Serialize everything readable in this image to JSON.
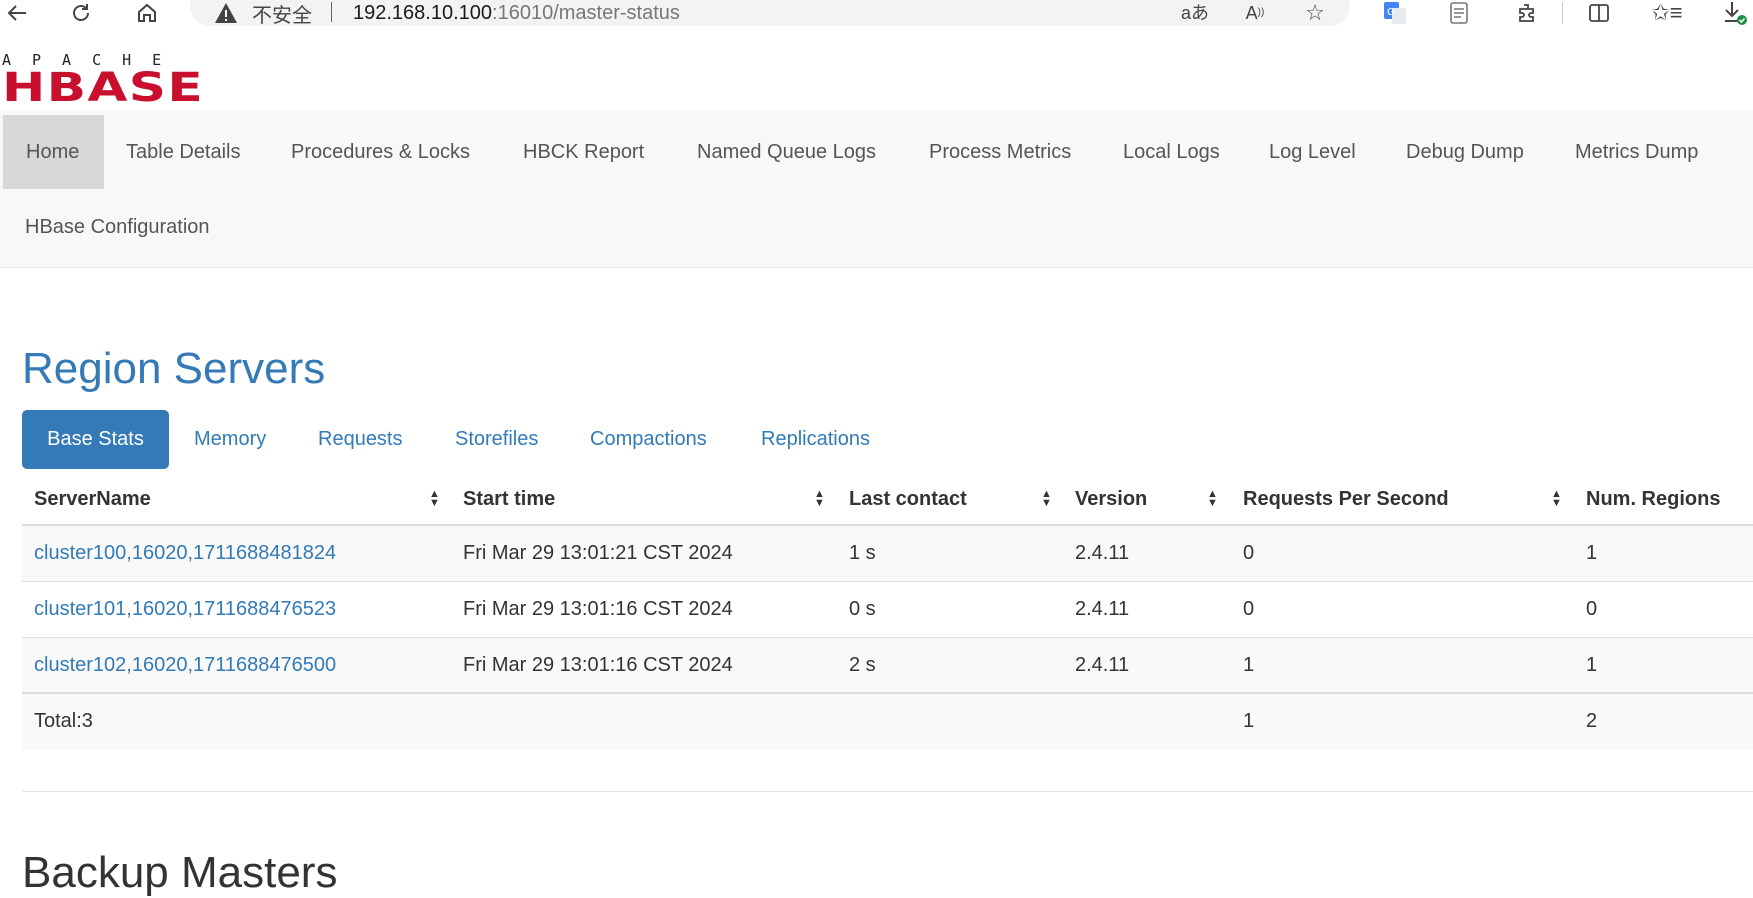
{
  "browser": {
    "insecure_label": "不安全",
    "url_host": "192.168.10.100",
    "url_rest": ":16010/master-status",
    "icons": [
      "back-icon",
      "refresh-icon",
      "home-icon",
      "warning-icon",
      "translate-icon",
      "read-aloud-icon",
      "favorite-star-icon",
      "google-translate-icon",
      "reading-view-icon",
      "extensions-icon",
      "split-screen-icon",
      "favorites-icon",
      "downloads-icon"
    ]
  },
  "logo": {
    "top_text": "APACHE",
    "main_text": "HBASE",
    "color": "#c8102e"
  },
  "navbar": {
    "items": [
      {
        "label": "Home",
        "active": true
      },
      {
        "label": "Table Details"
      },
      {
        "label": "Procedures & Locks"
      },
      {
        "label": "HBCK Report"
      },
      {
        "label": "Named Queue Logs"
      },
      {
        "label": "Process Metrics"
      },
      {
        "label": "Local Logs"
      },
      {
        "label": "Log Level"
      },
      {
        "label": "Debug Dump"
      },
      {
        "label": "Metrics Dump"
      },
      {
        "label": "HBase Configuration"
      }
    ]
  },
  "region_servers": {
    "title": "Region Servers",
    "tabs": [
      {
        "label": "Base Stats",
        "active": true
      },
      {
        "label": "Memory"
      },
      {
        "label": "Requests"
      },
      {
        "label": "Storefiles"
      },
      {
        "label": "Compactions"
      },
      {
        "label": "Replications"
      }
    ],
    "columns": [
      "ServerName",
      "Start time",
      "Last contact",
      "Version",
      "Requests Per Second",
      "Num. Regions"
    ],
    "rows": [
      [
        "cluster100,16020,1711688481824",
        "Fri Mar 29 13:01:21 CST 2024",
        "1 s",
        "2.4.11",
        "0",
        "1"
      ],
      [
        "cluster101,16020,1711688476523",
        "Fri Mar 29 13:01:16 CST 2024",
        "0 s",
        "2.4.11",
        "0",
        "0"
      ],
      [
        "cluster102,16020,1711688476500",
        "Fri Mar 29 13:01:16 CST 2024",
        "2 s",
        "2.4.11",
        "1",
        "1"
      ]
    ],
    "total": {
      "label": "Total:3",
      "requests": "1",
      "regions": "2"
    }
  },
  "next_section": {
    "title": "Backup Masters"
  },
  "colors": {
    "link": "#337ab7",
    "active_tab_bg": "#337ab7",
    "navbar_bg": "#f8f8f8",
    "active_nav_bg": "#d8d8d8"
  }
}
